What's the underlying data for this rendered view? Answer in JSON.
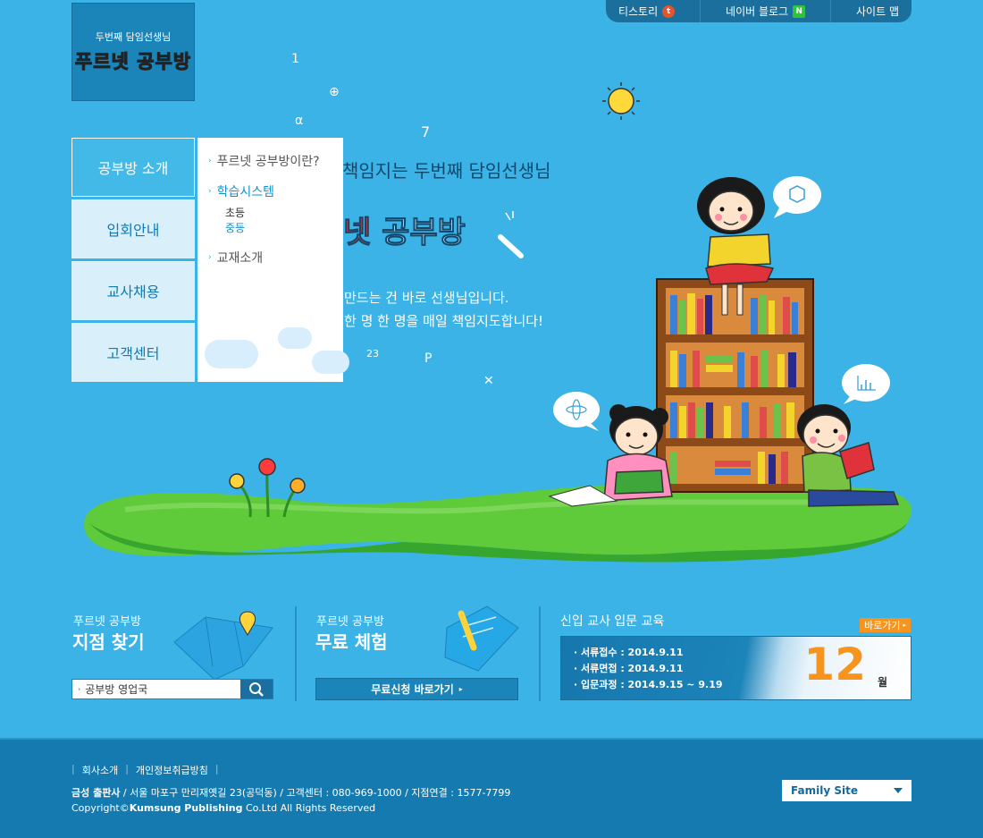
{
  "topbar": {
    "tistory": "티스토리",
    "naver_blog": "네이버 블로그",
    "sitemap": "사이트 맵"
  },
  "logo": {
    "subtitle": "두번째 담임선생님",
    "title_a": "푸",
    "title_b": "르",
    "title_c": "넷 공부방"
  },
  "nav": {
    "items": [
      {
        "label": "공부방 소개"
      },
      {
        "label": "입회안내"
      },
      {
        "label": "교사채용"
      },
      {
        "label": "고객센터"
      }
    ]
  },
  "submenu": {
    "item1": "푸르넷 공부방이란?",
    "item2": "학습시스템",
    "item2_sub1": "초등",
    "item2_sub2": "중등",
    "item3": "교재소개"
  },
  "hero": {
    "line1": "책임지는 두번째 담임선생님",
    "title_a": "넷",
    "title_b": " 공부방",
    "desc1": "만드는 건 바로 선생님입니다.",
    "desc2": "한 명 한 명을 매일 책임지도합니다!"
  },
  "bottom": {
    "branch": {
      "label": "푸르넷 공부방",
      "title": "지점 찾기",
      "search_value": "공부방 영업국"
    },
    "trial": {
      "label": "푸르넷 공부방",
      "title": "무료 체험",
      "button": "무료신청 바로가기"
    },
    "edu": {
      "title": "신입 교사 입문 교육",
      "more": "바로가기",
      "items": [
        "· 서류접수 : 2014.9.11",
        "· 서류면접 : 2014.9.11",
        "· 입문과정 : 2014.9.15 ~ 9.19"
      ],
      "month": "12",
      "month_unit": "월"
    }
  },
  "footer": {
    "link1": "회사소개",
    "link2": "개인정보취급방침",
    "company": "금성 출판사",
    "address": " / 서울 마포구 만리재옛길 23(공덕동)  /  고객센터 : 080-969-1000  /  지점연결 : 1577-7799",
    "copyright_a": "Copyright©",
    "copyright_b": "Kumsung Publishing",
    "copyright_c": " Co.Ltd  All Rights Reserved",
    "family_site": "Family Site"
  },
  "colors": {
    "background": "#3bb3e6",
    "accent_orange": "#f7941d",
    "footer": "#147ab0",
    "grass": "#5fcb3a"
  }
}
